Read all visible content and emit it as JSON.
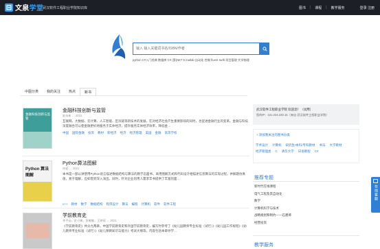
{
  "header": {
    "logo_main": "文泉",
    "logo_accent": "学堂",
    "subtitle": "武汉软件工程职业学院知识库",
    "nav": [
      "图书",
      "课程",
      "教学服务"
    ],
    "separator": "|",
    "auth": "登录 注册"
  },
  "search": {
    "placeholder": "输入 输入关键词书名/ISBN/作者",
    "hot_tags": "python  C#入门经典  数据库  C# (第)NET 5  matlab  自动化  控制  fluent  swift  项目管理  大学物理"
  },
  "tabs": [
    {
      "label": "中图分类",
      "active": false
    },
    {
      "label": "我的关注",
      "active": false
    },
    {
      "label": "热点",
      "active": false
    },
    {
      "label": "新书",
      "active": true
    }
  ],
  "books": [
    {
      "title": "金融科技创新与监管",
      "meta": "赵永新 … 2021",
      "desc": "互联网、大数据、云计算、人工智能、区块链等新技术的发展，在对经济社会产生重要影响的同时，也促进金融行业的变革。金融与科技深度融合可以使金融更好地服务于实体经济，提升服务实体经济效率，降低金…",
      "tags": [
        "中国",
        "国际金融",
        "投资",
        "教材",
        "新经济",
        "经济",
        "经济管理",
        "美国",
        "金融",
        "高等学校"
      ],
      "cover_title": "金融科技创新与监管",
      "cover_color": "#3d9e9a"
    },
    {
      "title": "Python算法图解",
      "meta": "何韬 … 2021",
      "desc": "本书是一部以讲使用Python语言描述数据结构与算法的教学态面书，采用图解方式和代码设计相描述信息算法的实现过程，并解题仿真值，易于理解，应如借到深入浅出。同时，针对企业的用人需求丰书提供了丰富的面…",
      "tags": [
        "c++",
        "教材",
        "数学",
        "数据结构",
        "程序设计",
        "算法",
        "编程",
        "计算机",
        "软件",
        "软件工程"
      ],
      "cover_title": "Python 算法图解",
      "cover_color": "#e8d04a"
    },
    {
      "title": "学前教育史",
      "meta": "李平云，史小娟，张敏敏，王晓丽 … 2021",
      "desc": "《学前教育史》共分九两章，中国学前教育史和外国学前教育史，编写时参考了《幼儿园教师专业标准（试行）》《幼儿园工作规程》《幼儿教师专业标准（试行）》《幼儿保教知识与能力》考试大纲等。内容包括本章导学…",
      "tags": [],
      "cover_title": "",
      "cover_color": "#c9c9c9"
    }
  ],
  "right_panel": {
    "user_line1": "武汉软件工程职业学院  欢迎您！（试用）",
    "user_line2": "您的IP：221.234.230.15（来自 武汉软件工程职业学院）",
    "add_link": "+ 添加我关注的图书分类",
    "links": [
      "学术设计",
      "计算机",
      "研究生/本科/专科教材",
      "书法",
      "大学教材",
      "经济管理类",
      "C",
      "清华大学",
      "日语教程",
      "C#"
    ],
    "recommend_title": "推荐专题",
    "recommend_items": [
      "新时代在线课程",
      "电气工程及其自动化",
      "数学",
      "计算机科学与技术",
      "战略规划和制约——石墨烯",
      "经营投资"
    ],
    "service_title": "教学服务"
  },
  "float_button": {
    "label": "在线客服"
  },
  "colors": {
    "topbar": "#1c1f26",
    "accent": "#2f7fd4",
    "logo_accent": "#2f9df5"
  }
}
